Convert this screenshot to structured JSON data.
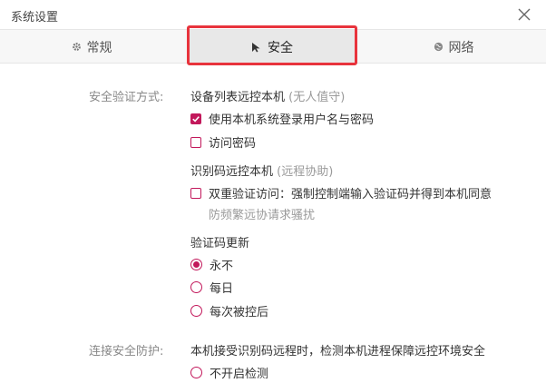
{
  "window": {
    "title": "系统设置"
  },
  "tabs": {
    "general": "常规",
    "security": "安全",
    "network": "网络"
  },
  "security": {
    "auth_label": "安全验证方式:",
    "device_list": {
      "title": "设备列表远控本机",
      "note": "(无人值守)",
      "options": [
        {
          "label": "使用本机系统登录用户名与密码",
          "checked": true
        },
        {
          "label": "访问密码",
          "checked": false
        }
      ]
    },
    "code_remote": {
      "title": "识别码远控本机",
      "note": "(远程协助)",
      "option": {
        "label": "双重验证访问：强制控制端输入验证码并得到本机同意",
        "checked": false
      },
      "hint": "防频繁远协请求骚扰"
    },
    "code_update": {
      "title": "验证码更新",
      "options": [
        {
          "label": "永不",
          "selected": true
        },
        {
          "label": "每日",
          "selected": false
        },
        {
          "label": "每次被控后",
          "selected": false
        }
      ]
    },
    "protection": {
      "label": "连接安全防护:",
      "desc": "本机接受识别码远程时，检测本机进程保障远控环境安全",
      "option": {
        "label": "不开启检测",
        "selected": false
      }
    }
  },
  "colors": {
    "accent": "#c2185b",
    "highlight": "#e8333c"
  }
}
